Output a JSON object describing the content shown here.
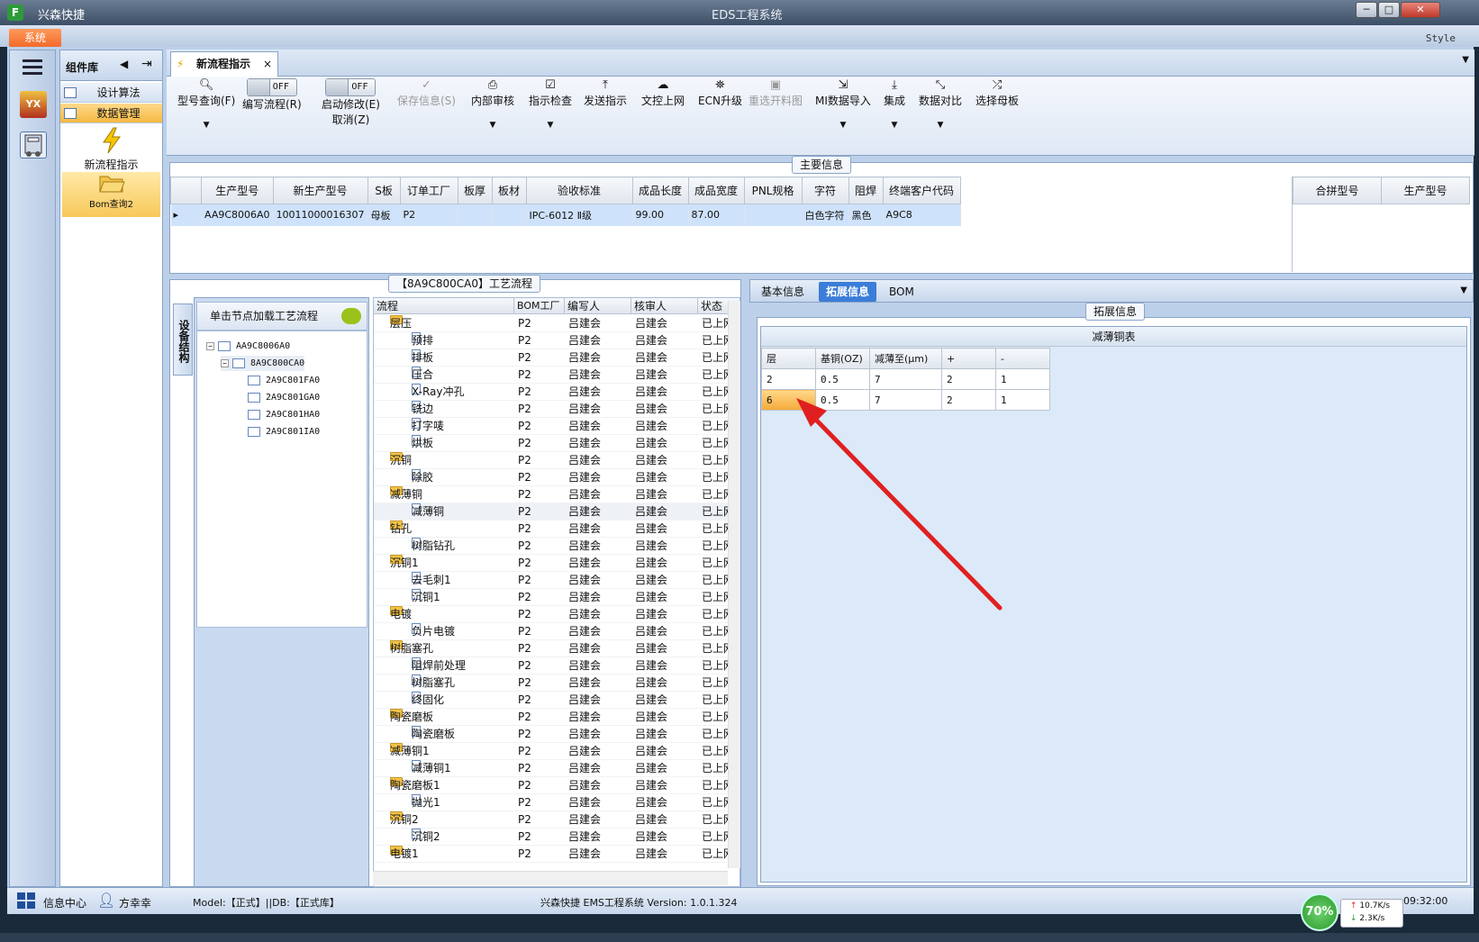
{
  "app": {
    "short_name": "兴森快捷",
    "window_title": "EDS工程系统",
    "logo_letter": "F"
  },
  "menu": {
    "system_label": "系统",
    "style_label": "Style"
  },
  "component_panel": {
    "title": "组件库",
    "items": [
      {
        "label": "设计算法"
      },
      {
        "label": "数据管理"
      }
    ],
    "big_items": [
      {
        "label": "新流程指示"
      },
      {
        "label": "Bom查询2"
      }
    ]
  },
  "left_bar": {
    "logo_text": "YX"
  },
  "doc_tab": {
    "label": "新流程指示"
  },
  "toolbar": {
    "model_query": "型号查询(F)",
    "write_flow": "编写流程(R)",
    "start_modify": "启动修改(E)",
    "cancel": "取消(Z)",
    "toggle_off": "OFF",
    "save_info": "保存信息(S)",
    "internal_review": "内部审核",
    "instruction_check": "指示检查",
    "send_instruction": "发送指示",
    "doc_upload": "文控上网",
    "ecn_upgrade": "ECN升级",
    "reselect_drawing": "重选开料图",
    "mi_import": "MI数据导入",
    "integration": "集成",
    "data_compare": "数据对比",
    "select_mother": "选择母板"
  },
  "main_info": {
    "title": "主要信息",
    "columns": [
      "生产型号",
      "新生产型号",
      "S板",
      "订单工厂",
      "板厚",
      "板材",
      "验收标准",
      "成品长度",
      "成品宽度",
      "PNL规格",
      "字符",
      "阻焊",
      "终端客户代码"
    ],
    "row": [
      "AA9C8006A0",
      "10011000016307",
      "母板",
      "P2",
      "",
      "",
      "IPC-6012 Ⅱ级",
      "99.00",
      "87.00",
      "",
      "白色字符",
      "黑色",
      "A9C8"
    ],
    "side_columns": [
      "合拼型号",
      "生产型号"
    ]
  },
  "process": {
    "title": "【8A9C800CA0】工艺流程",
    "vertical_tab": "设备结构",
    "nav_hint": "单击节点加载工艺流程",
    "tree": [
      {
        "label": "AA9C8006A0",
        "level": 0
      },
      {
        "label": "8A9C800CA0",
        "level": 1
      },
      {
        "label": "2A9C801FA0",
        "level": 2
      },
      {
        "label": "2A9C801GA0",
        "level": 2
      },
      {
        "label": "2A9C801HA0",
        "level": 2
      },
      {
        "label": "2A9C801IA0",
        "level": 2
      }
    ],
    "columns": [
      "流程",
      "BOM工厂",
      "编写人",
      "核审人",
      "状态"
    ],
    "rows": [
      {
        "name": "层压",
        "folder": true,
        "factory": "P2",
        "writer": "吕建会",
        "reviewer": "吕建会",
        "status": "已上网"
      },
      {
        "name": "预排",
        "folder": false,
        "factory": "P2",
        "writer": "吕建会",
        "reviewer": "吕建会",
        "status": "已上网"
      },
      {
        "name": "排板",
        "folder": false,
        "factory": "P2",
        "writer": "吕建会",
        "reviewer": "吕建会",
        "status": "已上网"
      },
      {
        "name": "压合",
        "folder": false,
        "factory": "P2",
        "writer": "吕建会",
        "reviewer": "吕建会",
        "status": "已上网"
      },
      {
        "name": "X-Ray冲孔",
        "folder": false,
        "factory": "P2",
        "writer": "吕建会",
        "reviewer": "吕建会",
        "status": "已上网"
      },
      {
        "name": "铣边",
        "folder": false,
        "factory": "P2",
        "writer": "吕建会",
        "reviewer": "吕建会",
        "status": "已上网"
      },
      {
        "name": "打字唛",
        "folder": false,
        "factory": "P2",
        "writer": "吕建会",
        "reviewer": "吕建会",
        "status": "已上网"
      },
      {
        "name": "烘板",
        "folder": false,
        "factory": "P2",
        "writer": "吕建会",
        "reviewer": "吕建会",
        "status": "已上网"
      },
      {
        "name": "沉铜",
        "folder": true,
        "factory": "P2",
        "writer": "吕建会",
        "reviewer": "吕建会",
        "status": "已上网"
      },
      {
        "name": "除胶",
        "folder": false,
        "factory": "P2",
        "writer": "吕建会",
        "reviewer": "吕建会",
        "status": "已上网"
      },
      {
        "name": "减薄铜",
        "folder": true,
        "factory": "P2",
        "writer": "吕建会",
        "reviewer": "吕建会",
        "status": "已上网"
      },
      {
        "name": "减薄铜",
        "folder": false,
        "factory": "P2",
        "writer": "吕建会",
        "reviewer": "吕建会",
        "status": "已上网",
        "highlight": true
      },
      {
        "name": "钻孔",
        "folder": true,
        "factory": "P2",
        "writer": "吕建会",
        "reviewer": "吕建会",
        "status": "已上网"
      },
      {
        "name": "树脂钻孔",
        "folder": false,
        "factory": "P2",
        "writer": "吕建会",
        "reviewer": "吕建会",
        "status": "已上网"
      },
      {
        "name": "沉铜1",
        "folder": true,
        "factory": "P2",
        "writer": "吕建会",
        "reviewer": "吕建会",
        "status": "已上网"
      },
      {
        "name": "去毛刺1",
        "folder": false,
        "factory": "P2",
        "writer": "吕建会",
        "reviewer": "吕建会",
        "status": "已上网"
      },
      {
        "name": "沉铜1",
        "folder": false,
        "factory": "P2",
        "writer": "吕建会",
        "reviewer": "吕建会",
        "status": "已上网"
      },
      {
        "name": "电镀",
        "folder": true,
        "factory": "P2",
        "writer": "吕建会",
        "reviewer": "吕建会",
        "status": "已上网"
      },
      {
        "name": "负片电镀",
        "folder": false,
        "factory": "P2",
        "writer": "吕建会",
        "reviewer": "吕建会",
        "status": "已上网"
      },
      {
        "name": "树脂塞孔",
        "folder": true,
        "factory": "P2",
        "writer": "吕建会",
        "reviewer": "吕建会",
        "status": "已上网"
      },
      {
        "name": "阻焊前处理",
        "folder": false,
        "factory": "P2",
        "writer": "吕建会",
        "reviewer": "吕建会",
        "status": "已上网"
      },
      {
        "name": "树脂塞孔",
        "folder": false,
        "factory": "P2",
        "writer": "吕建会",
        "reviewer": "吕建会",
        "status": "已上网"
      },
      {
        "name": "终固化",
        "folder": false,
        "factory": "P2",
        "writer": "吕建会",
        "reviewer": "吕建会",
        "status": "已上网"
      },
      {
        "name": "陶瓷磨板",
        "folder": true,
        "factory": "P2",
        "writer": "吕建会",
        "reviewer": "吕建会",
        "status": "已上网"
      },
      {
        "name": "陶瓷磨板",
        "folder": false,
        "factory": "P2",
        "writer": "吕建会",
        "reviewer": "吕建会",
        "status": "已上网"
      },
      {
        "name": "减薄铜1",
        "folder": true,
        "factory": "P2",
        "writer": "吕建会",
        "reviewer": "吕建会",
        "status": "已上网"
      },
      {
        "name": "减薄铜1",
        "folder": false,
        "factory": "P2",
        "writer": "吕建会",
        "reviewer": "吕建会",
        "status": "已上网"
      },
      {
        "name": "陶瓷磨板1",
        "folder": true,
        "factory": "P2",
        "writer": "吕建会",
        "reviewer": "吕建会",
        "status": "已上网"
      },
      {
        "name": "抛光1",
        "folder": false,
        "factory": "P2",
        "writer": "吕建会",
        "reviewer": "吕建会",
        "status": "已上网"
      },
      {
        "name": "沉铜2",
        "folder": true,
        "factory": "P2",
        "writer": "吕建会",
        "reviewer": "吕建会",
        "status": "已上网"
      },
      {
        "name": "沉铜2",
        "folder": false,
        "factory": "P2",
        "writer": "吕建会",
        "reviewer": "吕建会",
        "status": "已上网"
      },
      {
        "name": "电镀1",
        "folder": true,
        "factory": "P2",
        "writer": "吕建会",
        "reviewer": "吕建会",
        "status": "已上网"
      }
    ]
  },
  "right_panel": {
    "tabs": [
      {
        "label": "基本信息"
      },
      {
        "label": "拓展信息"
      },
      {
        "label": "BOM"
      }
    ],
    "ext_title": "拓展信息",
    "table_caption": "减薄铜表",
    "table_columns": [
      "层",
      "基铜(OZ)",
      "减薄至(μm)",
      "+",
      "-"
    ],
    "table_rows": [
      [
        "2",
        "0.5",
        "7",
        "2",
        "1"
      ],
      [
        "6",
        "0.5",
        "7",
        "2",
        "1"
      ]
    ],
    "annotation_color": "#e02020"
  },
  "status": {
    "info_center": "信息中心",
    "user": "方幸幸",
    "model_db": "Model:【正式】||DB:【正式库】",
    "version": "兴森快捷 EMS工程系统 Version: 1.0.1.324",
    "time": "09:32:00",
    "net_percent": "70%",
    "up_speed": "10.7K/s",
    "down_speed": "2.3K/s"
  },
  "colors": {
    "accent": "#3b7dd8",
    "selection": "#f5b943",
    "system_button": "#f26a2a"
  }
}
